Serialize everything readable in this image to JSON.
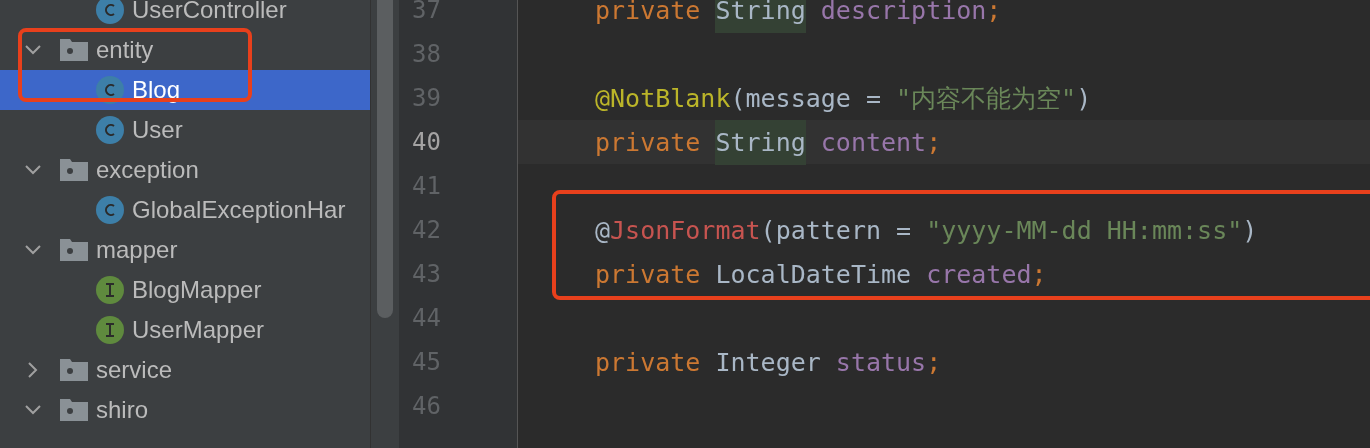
{
  "project_tree": {
    "leading_items": [
      {
        "name": "UserController",
        "kind": "class",
        "selected": false
      }
    ],
    "folders": [
      {
        "name": "entity",
        "expanded": true,
        "highlighted": true,
        "children": [
          {
            "name": "Blog",
            "kind": "class",
            "selected": true
          },
          {
            "name": "User",
            "kind": "class",
            "selected": false
          }
        ]
      },
      {
        "name": "exception",
        "expanded": true,
        "highlighted": false,
        "children": [
          {
            "name": "GlobalExceptionHar",
            "kind": "class",
            "selected": false
          }
        ]
      },
      {
        "name": "mapper",
        "expanded": true,
        "highlighted": false,
        "children": [
          {
            "name": "BlogMapper",
            "kind": "interface",
            "selected": false
          },
          {
            "name": "UserMapper",
            "kind": "interface",
            "selected": false
          }
        ]
      },
      {
        "name": "service",
        "expanded": false,
        "highlighted": false
      },
      {
        "name": "shiro",
        "expanded": true,
        "highlighted": false
      }
    ]
  },
  "editor": {
    "lines": [
      {
        "number": "37",
        "current": false,
        "highlighted": false,
        "tokens": [
          {
            "text": "private ",
            "kind": "keyword"
          },
          {
            "text": "String",
            "kind": "usage"
          },
          {
            "text": " description",
            "kind": "field"
          },
          {
            "text": ";",
            "kind": "keyword"
          }
        ]
      },
      {
        "number": "38",
        "current": false,
        "highlighted": false
      },
      {
        "number": "39",
        "current": false,
        "highlighted": false,
        "tokens": [
          {
            "text": "@NotBlank",
            "kind": "annotation"
          },
          {
            "text": "(message = ",
            "kind": "plain"
          },
          {
            "text": "\"内容不能为空\"",
            "kind": "string"
          },
          {
            "text": ")",
            "kind": "plain"
          }
        ]
      },
      {
        "number": "40",
        "current": true,
        "highlighted": false,
        "tokens": [
          {
            "text": "private ",
            "kind": "keyword"
          },
          {
            "text": "String",
            "kind": "usage"
          },
          {
            "text": " content",
            "kind": "field"
          },
          {
            "text": ";",
            "kind": "keyword"
          }
        ]
      },
      {
        "number": "41",
        "current": false,
        "highlighted": false
      },
      {
        "number": "42",
        "current": false,
        "highlighted": true,
        "tokens": [
          {
            "text": "@",
            "kind": "plain"
          },
          {
            "text": "JsonFormat",
            "kind": "error"
          },
          {
            "text": "(pattern = ",
            "kind": "plain"
          },
          {
            "text": "\"yyyy-MM-dd HH:mm:ss\"",
            "kind": "string"
          },
          {
            "text": ")",
            "kind": "plain"
          }
        ]
      },
      {
        "number": "43",
        "current": false,
        "highlighted": true,
        "tokens": [
          {
            "text": "private ",
            "kind": "keyword"
          },
          {
            "text": "LocalDateTime ",
            "kind": "plain"
          },
          {
            "text": "created",
            "kind": "field"
          },
          {
            "text": ";",
            "kind": "keyword"
          }
        ]
      },
      {
        "number": "44",
        "current": false,
        "highlighted": false
      },
      {
        "number": "45",
        "current": false,
        "highlighted": false,
        "tokens": [
          {
            "text": "private ",
            "kind": "keyword"
          },
          {
            "text": "Integer ",
            "kind": "plain"
          },
          {
            "text": "status",
            "kind": "field"
          },
          {
            "text": ";",
            "kind": "keyword"
          }
        ]
      },
      {
        "number": "46",
        "current": false,
        "highlighted": false
      }
    ]
  }
}
